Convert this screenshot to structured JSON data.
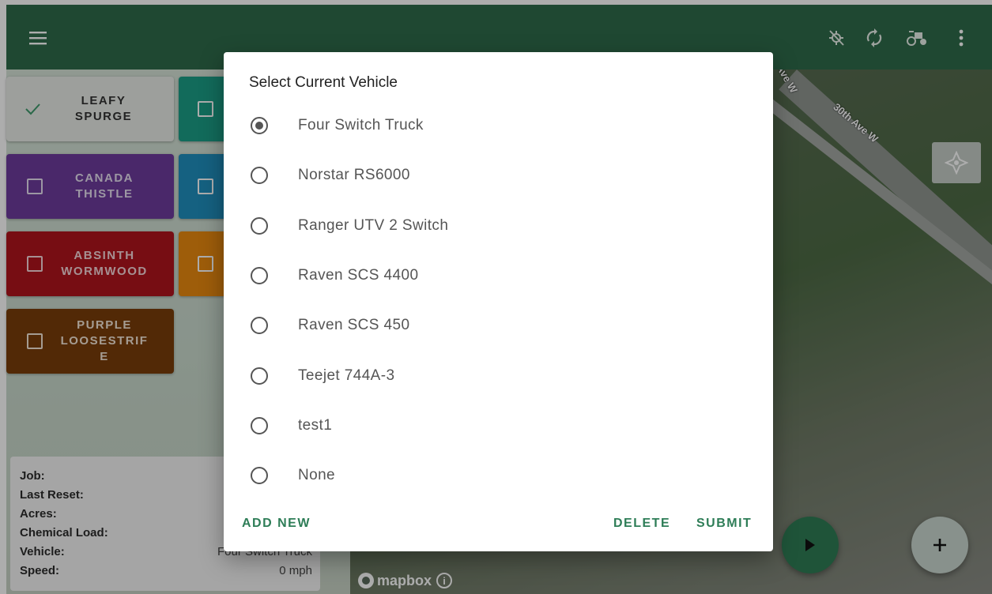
{
  "appbar": {
    "menu_icon": "hamburger-icon",
    "actions": [
      "gps-off-icon",
      "sync-icon",
      "tractor-icon",
      "more-vert-icon"
    ]
  },
  "weeds": [
    {
      "label": "LEAFY\nSPURGE",
      "checked": true,
      "color": "#e8ebe6",
      "text_color": "#333333"
    },
    {
      "label": "",
      "checked": false,
      "color": "#1b9e86",
      "text_color": "#ffffff"
    },
    {
      "label": "CANADA\nTHISTLE",
      "checked": false,
      "color": "#6d3b9d",
      "text_color": "#e6dff0"
    },
    {
      "label": "",
      "checked": false,
      "color": "#1f8fbf",
      "text_color": "#ffffff"
    },
    {
      "label": "ABSINTH\nWORMWOOD",
      "checked": false,
      "color": "#b0141d",
      "text_color": "#f5d5d7"
    },
    {
      "label": "",
      "checked": false,
      "color": "#e98a10",
      "text_color": "#ffffff"
    },
    {
      "label": "PURPLE\nLOOSESTRIF\nE",
      "checked": false,
      "color": "#7a3d0a",
      "text_color": "#f3e6d8"
    }
  ],
  "info": {
    "job_label": "Job:",
    "last_reset_label": "Last Reset:",
    "acres_label": "Acres:",
    "chemical_load_label": "Chemical Load:",
    "vehicle_label": "Vehicle:",
    "vehicle_value": "Four Switch Truck",
    "speed_label": "Speed:",
    "speed_value": "0 mph"
  },
  "map": {
    "street_labels": [
      "30th Ave W",
      "Ave W"
    ],
    "attribution": "mapbox",
    "info_icon": "info-icon",
    "compass_icon": "compass-icon"
  },
  "dialog": {
    "title": "Select Current Vehicle",
    "options": [
      {
        "label": "Four Switch Truck",
        "selected": true
      },
      {
        "label": "Norstar RS6000",
        "selected": false
      },
      {
        "label": "Ranger UTV 2 Switch",
        "selected": false
      },
      {
        "label": "Raven SCS 4400",
        "selected": false
      },
      {
        "label": "Raven SCS 450",
        "selected": false
      },
      {
        "label": "Teejet 744A-3",
        "selected": false
      },
      {
        "label": "test1",
        "selected": false
      },
      {
        "label": "None",
        "selected": false
      }
    ],
    "add_new": "ADD NEW",
    "delete": "DELETE",
    "submit": "SUBMIT"
  },
  "fabs": {
    "play_icon": "play-icon",
    "add_icon": "plus-icon"
  },
  "colors": {
    "appbar": "#2e6b4a",
    "accent": "#2e7d57",
    "play_fab": "#2f7d55",
    "add_fab": "#c9d6cf"
  }
}
